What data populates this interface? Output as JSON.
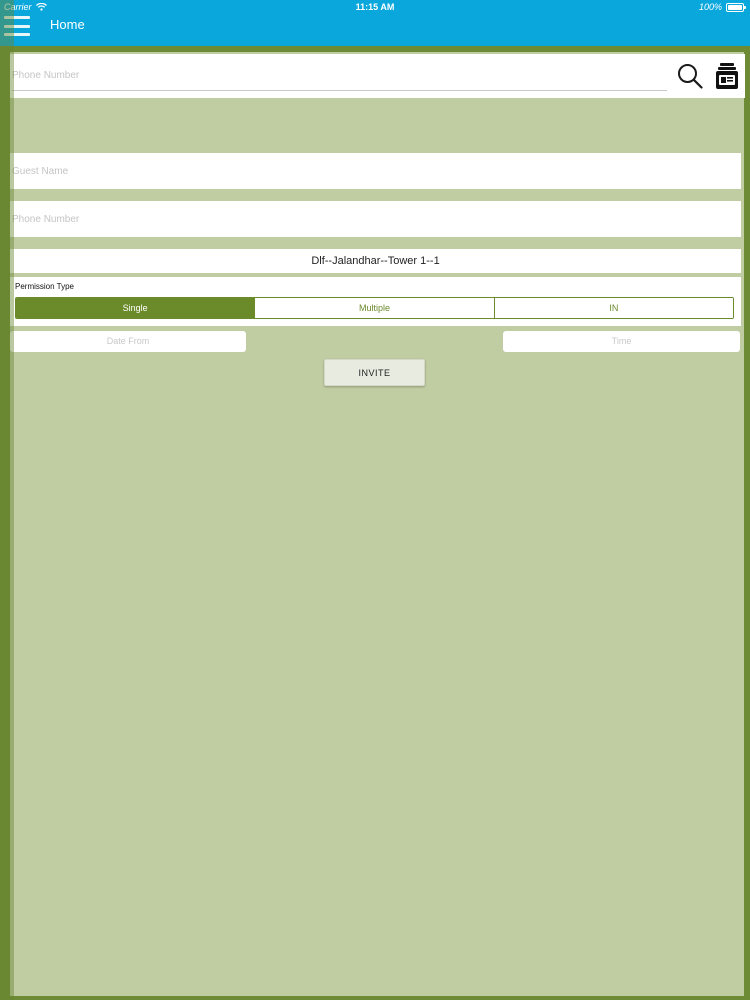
{
  "status_bar": {
    "carrier": "Carrier",
    "time": "11:15 AM",
    "battery": "100%"
  },
  "header": {
    "title": "Home"
  },
  "search": {
    "placeholder": "Phone Number"
  },
  "form": {
    "guest_name_placeholder": "Guest Name",
    "phone_number_placeholder": "Phone Number",
    "location": "Dlf--Jalandhar--Tower 1--1",
    "permission_type_label": "Permission Type",
    "permission_options": [
      "Single",
      "Multiple",
      "IN"
    ],
    "selected_permission": "Single",
    "date_from_placeholder": "Date From",
    "time_placeholder": "Time",
    "invite_label": "INVITE"
  },
  "colors": {
    "header": "#0aa7dd",
    "accent": "#6b8a2a",
    "background": "#c0cca2"
  },
  "icons": {
    "menu": "menu-icon",
    "search": "search-icon",
    "contact": "contact-card-icon",
    "wifi": "wifi-icon",
    "battery": "battery-icon"
  }
}
